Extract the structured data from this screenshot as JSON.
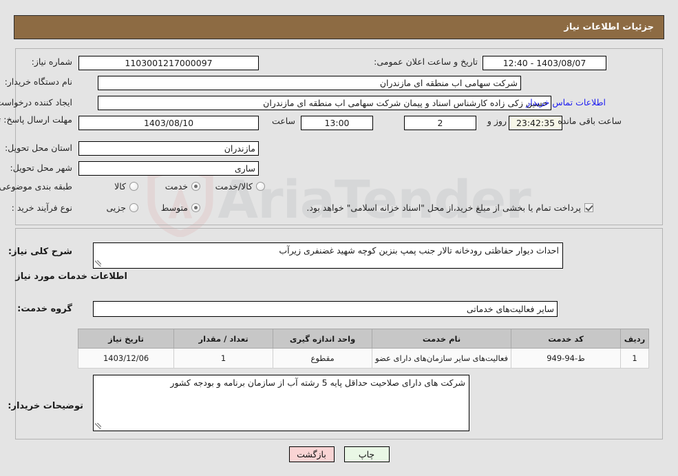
{
  "header": {
    "title": "جزئیات اطلاعات نیاز"
  },
  "form": {
    "need_number_label": "شماره نیاز:",
    "need_number_value": "1103001217000097",
    "announce_label": "تاریخ و ساعت اعلان عمومی:",
    "announce_value": "1403/08/07 - 12:40",
    "buyer_org_label": "نام دستگاه خریدار:",
    "buyer_org_value": "شرکت سهامی اب منطقه ای مازندران",
    "creator_label": "ایجاد کننده درخواست:",
    "creator_value": "حسین زکی زاده کارشناس اسناد و پیمان شرکت سهامی اب منطقه ای مازندران",
    "contact_link": "اطلاعات تماس خریدار",
    "deadline_label": "مهلت ارسال پاسخ: تا تاریخ:",
    "deadline_date": "1403/08/10",
    "hour_label": "ساعت",
    "deadline_hour": "13:00",
    "days_value": "2",
    "days_label": "روز و",
    "countdown_value": "23:42:35",
    "countdown_label": "ساعت باقی مانده",
    "province_label": "استان محل تحویل:",
    "province_value": "مازندران",
    "city_label": "شهر محل تحویل:",
    "city_value": "ساری",
    "category_label": "طبقه بندی موضوعی:",
    "category_options": [
      {
        "label": "کالا",
        "selected": false
      },
      {
        "label": "خدمت",
        "selected": true
      },
      {
        "label": "کالا/خدمت",
        "selected": false
      }
    ],
    "process_label": "نوع فرآیند خرید :",
    "process_options": [
      {
        "label": "جزیی",
        "selected": false
      },
      {
        "label": "متوسط",
        "selected": true
      }
    ],
    "treasury_checkbox_label": "پرداخت تمام یا بخشی از مبلغ خرید،از محل \"اسناد خزانه اسلامی\" خواهد بود.",
    "treasury_checked": true
  },
  "description": {
    "label": "شرح کلی نیاز:",
    "value": "احداث دیوار حفاظتی رودخانه تالار جنب پمپ بنزین کوچه شهید غضنفری زیرآب"
  },
  "services_section": {
    "heading": "اطلاعات خدمات مورد نیاز",
    "group_label": "گروه خدمت:",
    "group_value": "سایر فعالیت‌های خدماتی"
  },
  "table": {
    "headers": [
      "ردیف",
      "کد خدمت",
      "نام خدمت",
      "واحد اندازه گیری",
      "تعداد / مقدار",
      "تاریخ نیاز"
    ],
    "rows": [
      {
        "index": "1",
        "code": "ط-94-949",
        "name": "فعالیت‌های سایر سازمان‌های دارای عضو",
        "unit": "مقطوع",
        "qty": "1",
        "date": "1403/12/06"
      }
    ]
  },
  "buyer_notes": {
    "label": "توضیحات خریدار:",
    "value": "شرکت های دارای صلاحیت حداقل پایه 5 رشته آب از سازمان برنامه و بودجه کشور"
  },
  "buttons": {
    "print": "چاپ",
    "back": "بازگشت"
  },
  "watermark": {
    "text": "AriaTender"
  },
  "colors": {
    "header_bg": "#8d6b43",
    "page_bg": "#e4e4e4",
    "link": "#1d1df0",
    "print_btn": "#e9f7e5",
    "back_btn": "#f9d4d4"
  }
}
